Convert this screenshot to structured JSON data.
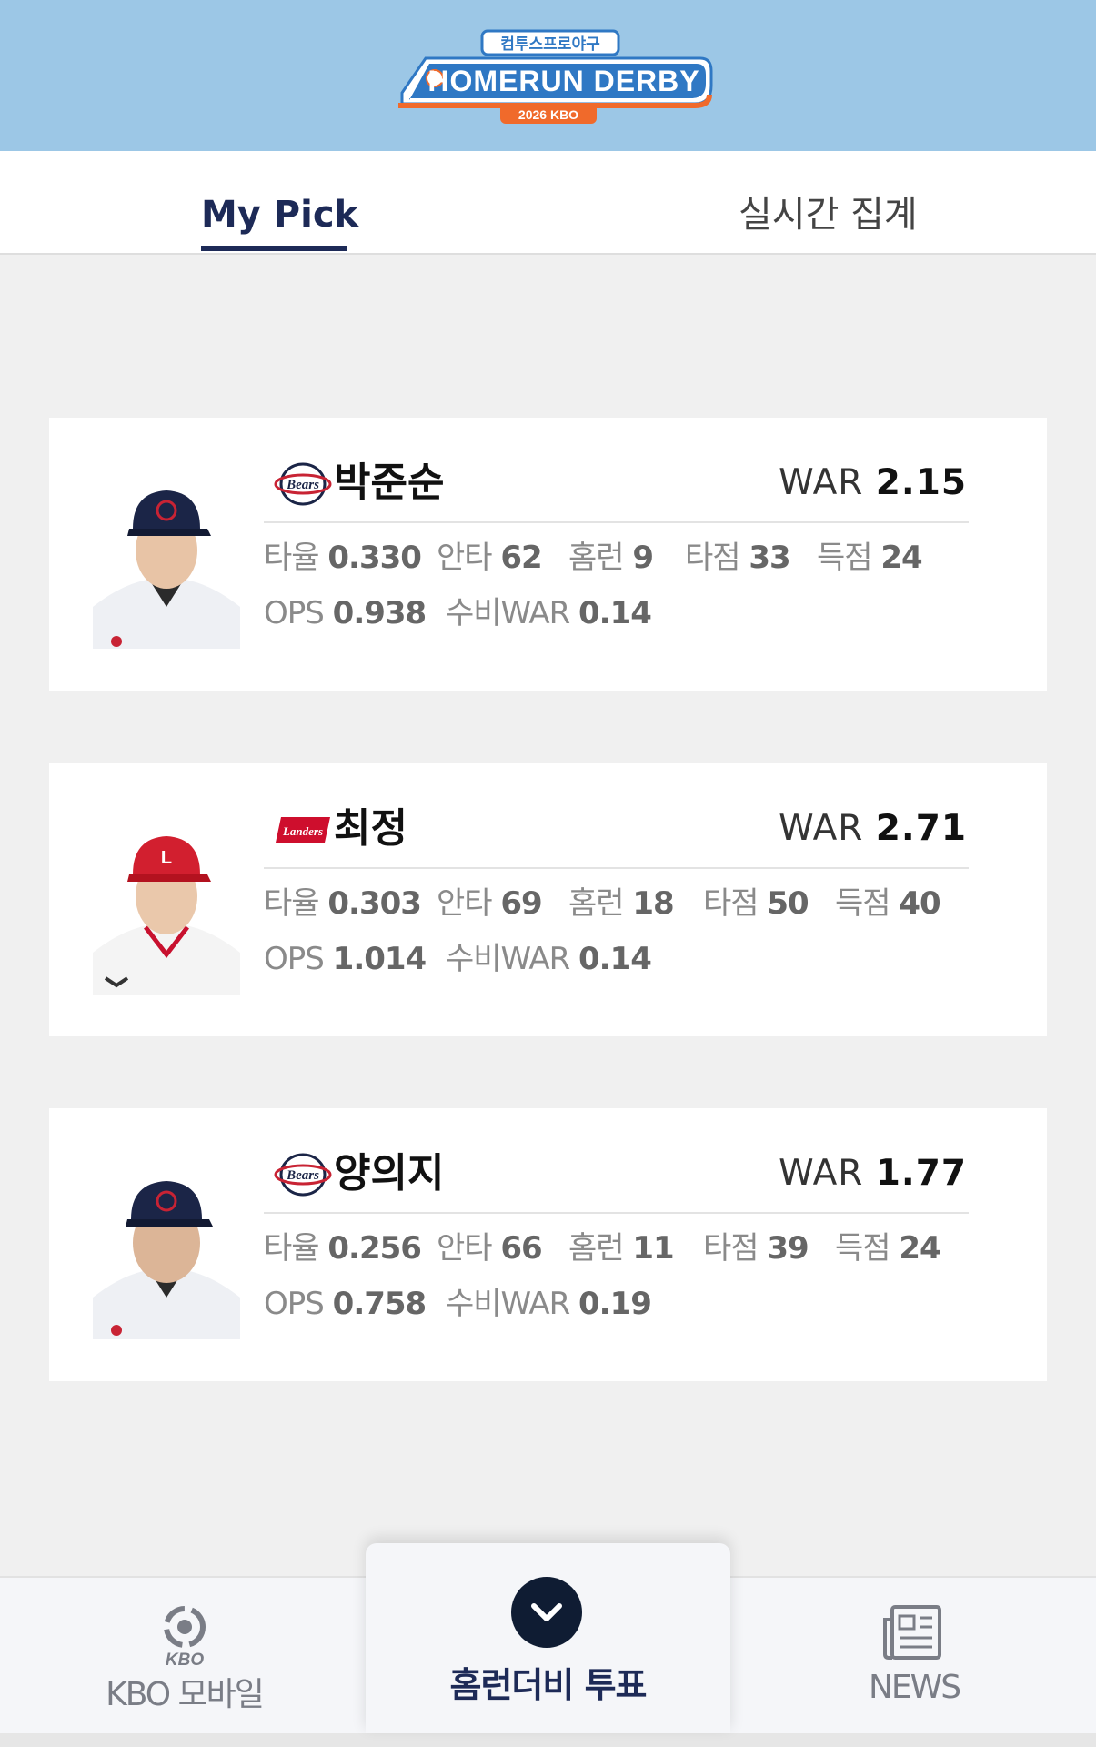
{
  "header": {
    "logo_top": "컴투스프로야구",
    "logo_main": "HOMERUN DERBY",
    "logo_sub": "2026 KBO"
  },
  "tabs": [
    {
      "label": "My Pick",
      "active": true
    },
    {
      "label": "실시간 집계",
      "active": false
    }
  ],
  "players": [
    {
      "team_icon": "bears-logo-icon",
      "team_logo_text": "Bears",
      "name": "박준순",
      "war_label": "WAR",
      "war": "2.15",
      "stats1": [
        {
          "label": "타율",
          "value": "0.330"
        },
        {
          "label": "안타",
          "value": "62"
        },
        {
          "label": "홈런",
          "value": "9"
        },
        {
          "label": "타점",
          "value": "33"
        },
        {
          "label": "득점",
          "value": "24"
        }
      ],
      "stats2": [
        {
          "label": "OPS",
          "value": "0.938"
        },
        {
          "label": "수비WAR",
          "value": "0.14"
        }
      ]
    },
    {
      "team_icon": "landers-logo-icon",
      "team_logo_text": "Landers",
      "name": "최정",
      "war_label": "WAR",
      "war": "2.71",
      "stats1": [
        {
          "label": "타율",
          "value": "0.303"
        },
        {
          "label": "안타",
          "value": "69"
        },
        {
          "label": "홈런",
          "value": "18"
        },
        {
          "label": "타점",
          "value": "50"
        },
        {
          "label": "득점",
          "value": "40"
        }
      ],
      "stats2": [
        {
          "label": "OPS",
          "value": "1.014"
        },
        {
          "label": "수비WAR",
          "value": "0.14"
        }
      ]
    },
    {
      "team_icon": "bears-logo-icon",
      "team_logo_text": "Bears",
      "name": "양의지",
      "war_label": "WAR",
      "war": "1.77",
      "stats1": [
        {
          "label": "타율",
          "value": "0.256"
        },
        {
          "label": "안타",
          "value": "66"
        },
        {
          "label": "홈런",
          "value": "11"
        },
        {
          "label": "타점",
          "value": "39"
        },
        {
          "label": "득점",
          "value": "24"
        }
      ],
      "stats2": [
        {
          "label": "OPS",
          "value": "0.758"
        },
        {
          "label": "수비WAR",
          "value": "0.19"
        }
      ]
    }
  ],
  "bottom_nav": {
    "kbo": {
      "icon": "kbo-logo-icon",
      "logo_text": "KBO",
      "label": "KBO 모바일"
    },
    "vote": {
      "icon": "chevron-down-icon",
      "label": "홈런더비 투표"
    },
    "news": {
      "icon": "newspaper-icon",
      "label": "NEWS"
    }
  },
  "colors": {
    "header_bg": "#9cc7e6",
    "accent_navy": "#1d2a57",
    "logo_orange": "#f06a2b",
    "logo_blue": "#2f78c4"
  }
}
